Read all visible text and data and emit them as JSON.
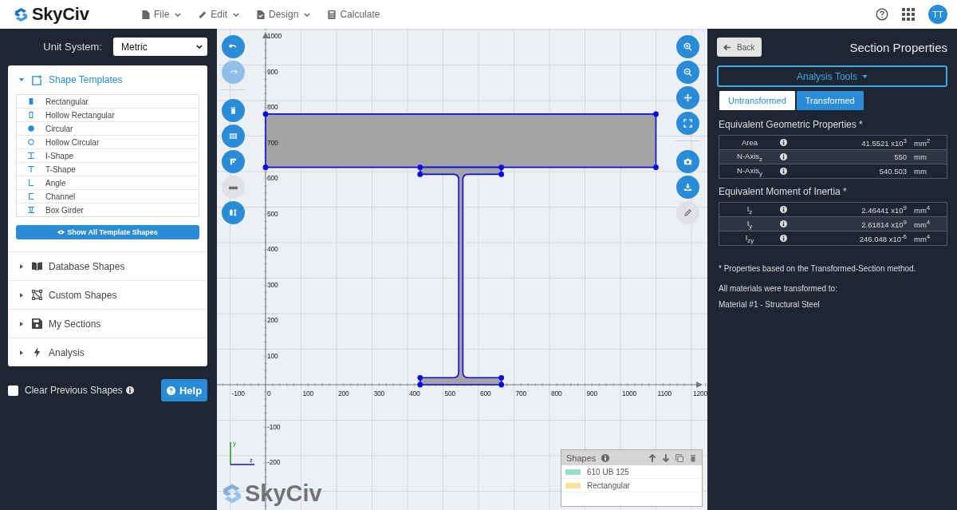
{
  "header": {
    "logo": "SkyCiv",
    "menu": [
      {
        "label": "File",
        "dropdown": true
      },
      {
        "label": "Edit",
        "dropdown": true
      },
      {
        "label": "Design",
        "dropdown": true
      },
      {
        "label": "Calculate",
        "dropdown": false
      }
    ],
    "avatar": "TT"
  },
  "left": {
    "unit_label": "Unit System:",
    "unit_value": "Metric",
    "sections": [
      {
        "label": "Shape Templates",
        "expanded": true,
        "items": [
          {
            "label": "Rectangular"
          },
          {
            "label": "Hollow Rectangular"
          },
          {
            "label": "Circular"
          },
          {
            "label": "Hollow Circular"
          },
          {
            "label": "I-Shape"
          },
          {
            "label": "T-Shape"
          },
          {
            "label": "Angle"
          },
          {
            "label": "Channel"
          },
          {
            "label": "Box Girder"
          }
        ],
        "show_all": "Show All Template Shapes"
      },
      {
        "label": "Database Shapes",
        "expanded": false
      },
      {
        "label": "Custom Shapes",
        "expanded": false
      },
      {
        "label": "My Sections",
        "expanded": false
      },
      {
        "label": "Analysis",
        "expanded": false
      }
    ],
    "clear_label": "Clear Previous Shapes",
    "clear_checked": false,
    "help": "Help"
  },
  "canvas": {
    "x_ticks": [
      "-100",
      "0",
      "100",
      "200",
      "300",
      "400",
      "500",
      "600",
      "700",
      "800",
      "900",
      "1000",
      "1100",
      "1200"
    ],
    "y_ticks": [
      "1000",
      "900",
      "800",
      "700",
      "600",
      "500",
      "400",
      "300",
      "200",
      "100",
      "-100",
      "-200"
    ],
    "axis_y": "y",
    "axis_z": "z",
    "logo": "SkyCiv",
    "tools_left": [
      {
        "disabled": false,
        "kind": "primary"
      },
      {
        "disabled": true,
        "kind": "primary"
      },
      {
        "disabled": false,
        "kind": "primary"
      },
      {
        "disabled": false,
        "kind": "primary"
      },
      {
        "disabled": false,
        "kind": "primary"
      },
      {
        "disabled": false,
        "kind": "secondary"
      },
      {
        "disabled": false,
        "kind": "primary"
      }
    ],
    "tools_right": [
      {
        "disabled": false,
        "kind": "primary"
      },
      {
        "disabled": false,
        "kind": "primary"
      },
      {
        "disabled": false,
        "kind": "primary"
      },
      {
        "disabled": false,
        "kind": "primary"
      },
      {
        "disabled": false,
        "kind": "primary"
      },
      {
        "disabled": false,
        "kind": "primary"
      },
      {
        "disabled": false,
        "kind": "secondary"
      }
    ],
    "shapes_panel": {
      "title": "Shapes",
      "items": [
        {
          "label": "610 UB 125",
          "color": "#98e0c4"
        },
        {
          "label": "Rectangular",
          "color": "#f7e09a"
        }
      ]
    }
  },
  "right": {
    "back": "Back",
    "title": "Section Properties",
    "tools": "Analysis Tools",
    "tabs": [
      {
        "label": "Untransformed",
        "selected": false
      },
      {
        "label": "Transformed",
        "selected": true
      }
    ],
    "tables": [
      {
        "heading": "Equivalent Geometric Properties *",
        "rows": [
          {
            "label": "Area",
            "value": "41.5521 x10$^{3}$",
            "unit": "mm$^{2}$"
          },
          {
            "label": "N-Axis$_{z}$",
            "value": "550",
            "unit": "mm"
          },
          {
            "label": "N-Axis$_{y}$",
            "value": "540.503",
            "unit": "mm"
          }
        ]
      },
      {
        "heading": "Equivalent Moment of Inertia *",
        "rows": [
          {
            "label": "I$_{z}$",
            "value": "2.46441 x10$^{9}$",
            "unit": "mm$^{4}$"
          },
          {
            "label": "I$_{y}$",
            "value": "2.61814 x10$^{9}$",
            "unit": "mm$^{4}$"
          },
          {
            "label": "I$_{zy}$",
            "value": "246.048 x10$^{-6}$",
            "unit": "mm$^{4}$"
          }
        ]
      }
    ],
    "note": "* Properties based on the Transformed-Section method.",
    "material_intro": "All materials were transformed to:",
    "material": "Material #1 - Structural Steel"
  }
}
